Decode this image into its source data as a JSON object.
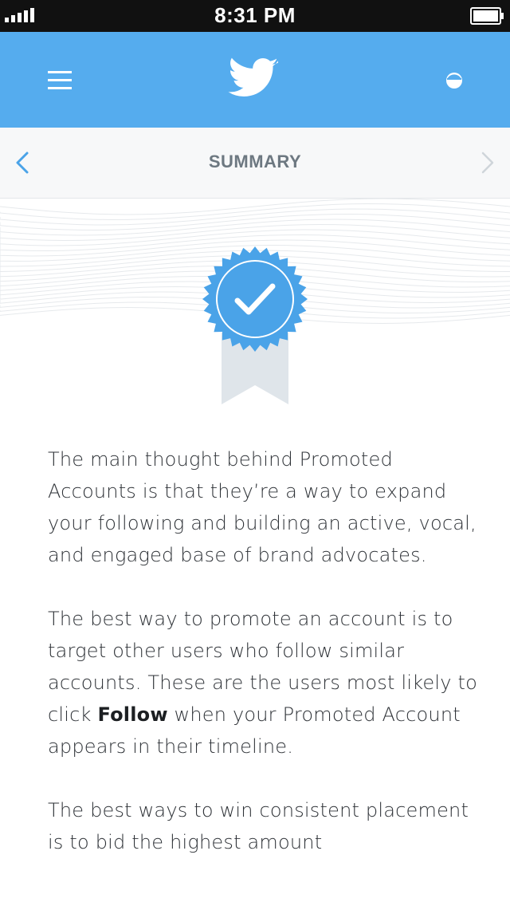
{
  "status_bar": {
    "time": "8:31 PM"
  },
  "icons": {
    "signal": "signal-bars-icon",
    "battery": "battery-icon",
    "menu": "hamburger-menu-icon",
    "logo": "twitter-bird-icon",
    "status": "half-circle-icon",
    "back": "chevron-left-icon",
    "forward": "chevron-right-icon",
    "badge": "checkmark-ribbon-badge-icon"
  },
  "colors": {
    "header": "#55acee",
    "accent": "#4aa3e8",
    "ribbon": "#dfe5ea",
    "text": "#2e3237"
  },
  "sub_nav": {
    "title": "SUMMARY"
  },
  "content": {
    "paragraph_1": "The main thought behind Promoted Accounts is that they’re a way to expand your following and building an active, vocal, and engaged base of brand advocates.",
    "paragraph_2": {
      "before": "The best way to promote an account is to target other users who follow similar accounts. These are the users most likely to click ",
      "bold": "Follow",
      "after": " when your Promoted Account appears in their timeline."
    },
    "paragraph_3": "The best ways to win consistent placement is to bid the highest amount"
  }
}
